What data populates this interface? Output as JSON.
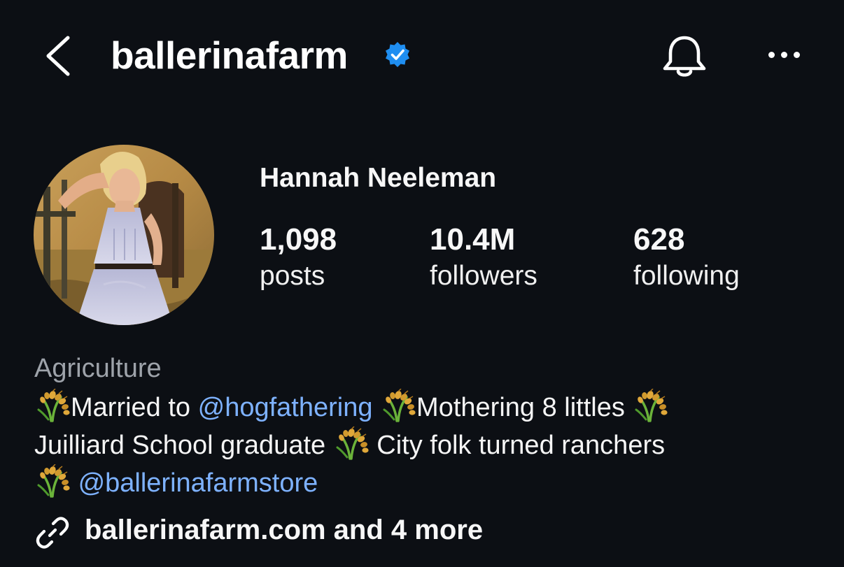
{
  "header": {
    "username": "ballerinafarm",
    "back_icon": "chevron-left-icon",
    "verified_icon": "verified-badge-icon",
    "bell_icon": "bell-icon",
    "more_icon": "more-horizontal-icon"
  },
  "profile": {
    "display_name": "Hannah Neeleman",
    "avatar": "profile-photo"
  },
  "stats": {
    "posts": {
      "value": "1,098",
      "label": "posts"
    },
    "followers": {
      "value": "10.4M",
      "label": "followers"
    },
    "following": {
      "value": "628",
      "label": "following"
    }
  },
  "bio": {
    "category": "Agriculture",
    "line1": {
      "t1": "Married to ",
      "mention1": "@hogfathering",
      "t2": " ",
      "t3": "Mothering 8 littles "
    },
    "line2": {
      "t1": "Juilliard School graduate ",
      "t2": " City folk turned ranchers"
    },
    "line3": {
      "t1": " ",
      "mention": "@ballerinafarmstore"
    },
    "emoji_icon": "sheaf-of-rice-icon"
  },
  "link": {
    "text": "ballerinafarm.com and 4 more",
    "icon": "link-icon"
  },
  "colors": {
    "background": "#0c0f14",
    "text": "#f5f5f5",
    "secondary": "#9ea3aa",
    "mention": "#7eb2ff",
    "verified": "#1f8ef1"
  }
}
